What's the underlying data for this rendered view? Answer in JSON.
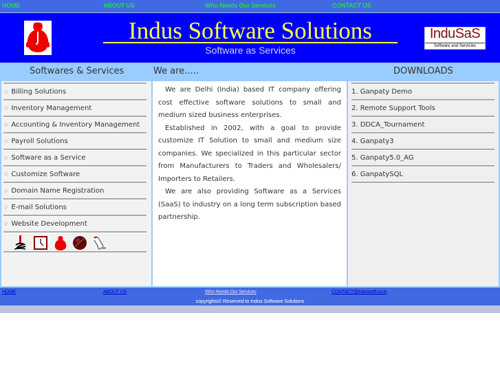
{
  "top_nav": {
    "items": [
      {
        "label": "HOME"
      },
      {
        "label": "ABOUT US"
      },
      {
        "label": "Who Needs Our Services"
      },
      {
        "label": "CONTACT US"
      }
    ],
    "link_color": "#22dd44",
    "background": "#4169e1"
  },
  "banner": {
    "title": "Indus Software Solutions",
    "subtitle": "Software as Services",
    "right_logo": {
      "text": "InduSaS",
      "tagline": "Software and Servicies"
    },
    "background": "#0000ff",
    "title_color": "#ffff44"
  },
  "headings": {
    "left": "Softwares & Services",
    "middle": "We are.....",
    "right": "DOWNLOADS"
  },
  "services_menu": {
    "items": [
      {
        "label": "Billing Solutions"
      },
      {
        "label": "Inventory Management"
      },
      {
        "label": "Accounting & Inventory Management"
      },
      {
        "label": "Payroll Solutions"
      },
      {
        "label": "Software as a Service"
      },
      {
        "label": "Customize Software"
      },
      {
        "label": "Domain Name Registration"
      },
      {
        "label": "E-mail Solutions"
      },
      {
        "label": "Website Development"
      }
    ],
    "icons": [
      "signature-logo-icon",
      "clock-icon",
      "ganesh-icon",
      "cricket-ball-icon",
      "hand-pointer-icon"
    ]
  },
  "about": {
    "paragraphs": [
      "We are Delhi (India) based IT company offering cost effective software solutions to small and medium sized business enterprises.",
      "Established in 2002, with a goal to provide customize IT Solution to small and medium size companies. We specialized in this particular sector from Manufacturers to Traders and Wholesalers/ Importers to Retailers.",
      "We are also providing Software as a Services (SaaS) to industry on a long term subscription based partnership."
    ]
  },
  "downloads": {
    "items": [
      {
        "label": "1. Ganpaty Demo"
      },
      {
        "label": "2. Remote Support Tools"
      },
      {
        "label": "3. DDCA_Tournament"
      },
      {
        "label": "4. Ganpaty3"
      },
      {
        "label": "5. Ganpaty5.0_AG"
      },
      {
        "label": "6. GanpatySQL"
      }
    ]
  },
  "footer": {
    "links": [
      {
        "label": "HOME",
        "color": "#0000cc"
      },
      {
        "label": "ABOUT US",
        "color": "#0000cc"
      },
      {
        "label": "Who Needs Our Services",
        "color": "#e0e0ff"
      },
      {
        "label": "CONTACT@indussoft.co.in",
        "color": "#0000cc"
      }
    ],
    "copyright": "copyrights© Reserved to Indus Software Solutions"
  }
}
